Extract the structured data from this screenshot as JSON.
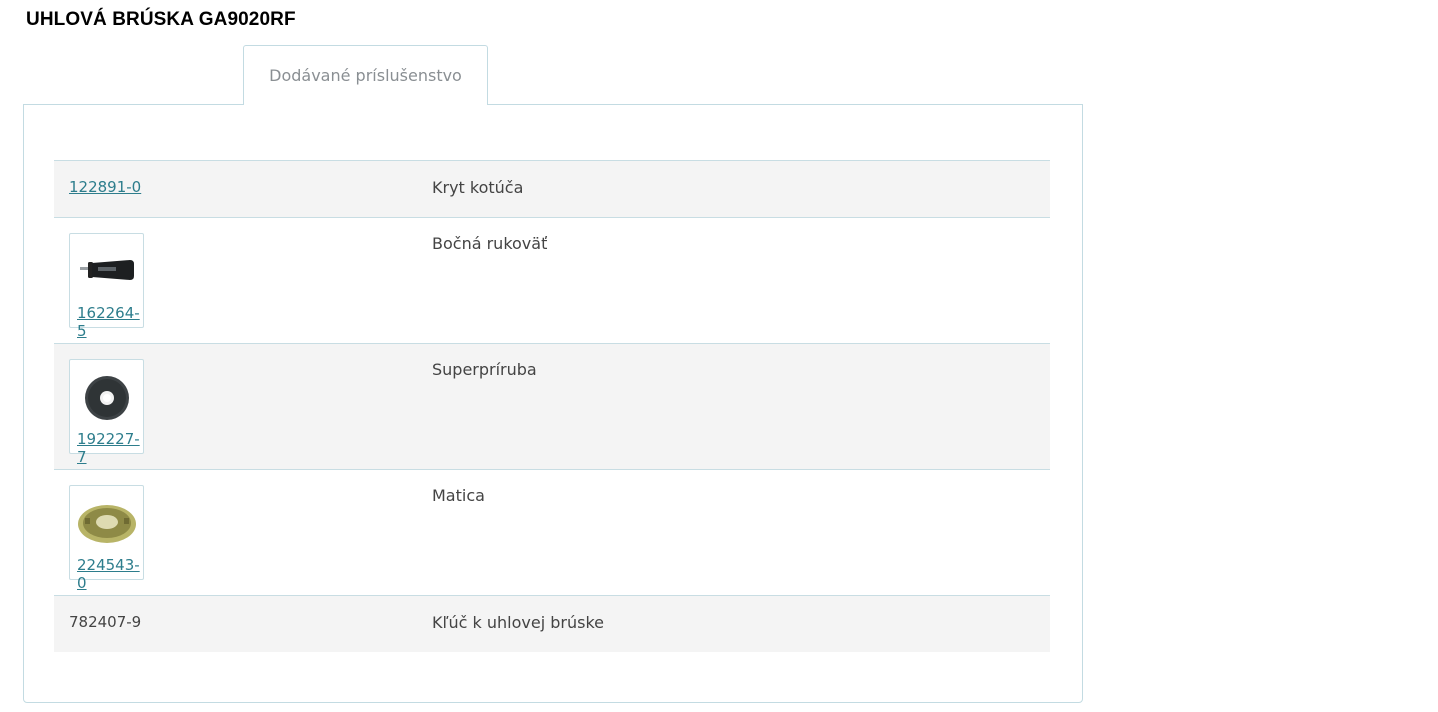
{
  "page": {
    "title": "UHLOVÁ BRÚSKA GA9020RF"
  },
  "tabs": [
    {
      "label": "Dodávané príslušenstvo"
    }
  ],
  "accessories": [
    {
      "code": "122891-0",
      "description": "Kryt kotúča",
      "linked": true,
      "image": null
    },
    {
      "code": "162264-5",
      "description": "Bočná rukoväť",
      "linked": true,
      "image": "side-handle-icon"
    },
    {
      "code": "192227-7",
      "description": "Superpríruba",
      "linked": true,
      "image": "flange-icon"
    },
    {
      "code": "224543-0",
      "description": "Matica",
      "linked": true,
      "image": "lock-nut-icon"
    },
    {
      "code": "782407-9",
      "description": "Kľúč k uhlovej brúske",
      "linked": false,
      "image": null
    }
  ],
  "colors": {
    "link": "#2d7d8c",
    "border": "#c3dbe2",
    "row_shade": "#f4f4f4",
    "text": "#444444"
  }
}
